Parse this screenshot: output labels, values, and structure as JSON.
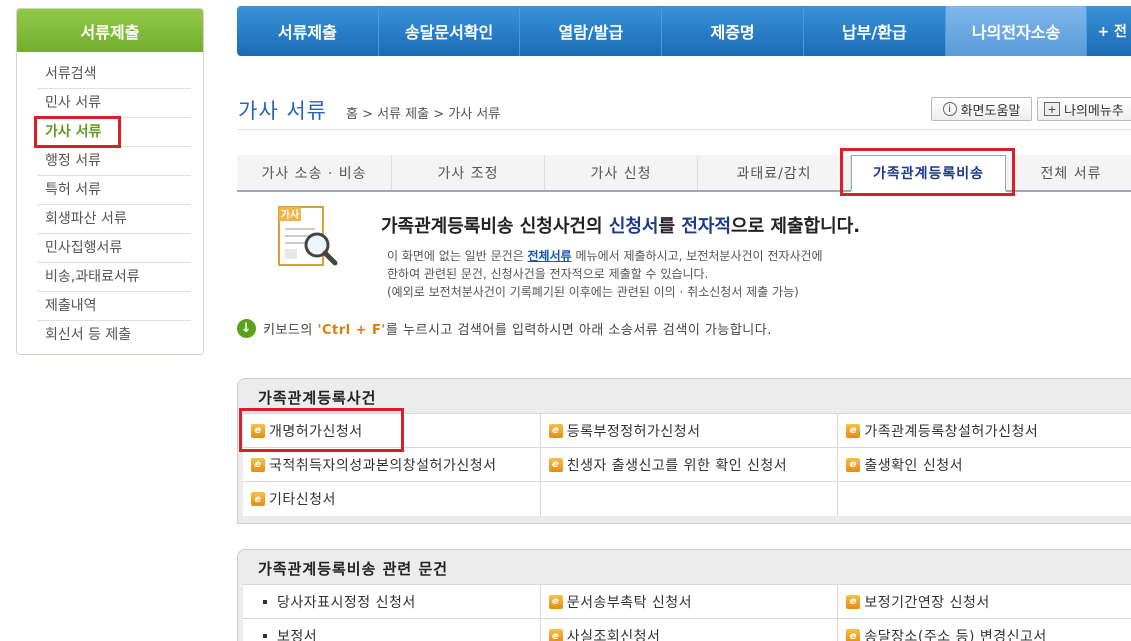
{
  "sidebar": {
    "title": "서류제출",
    "items": [
      {
        "label": "서류검색"
      },
      {
        "label": "민사 서류"
      },
      {
        "label": "가사 서류"
      },
      {
        "label": "행정 서류"
      },
      {
        "label": "특허 서류"
      },
      {
        "label": "회생파산 서류"
      },
      {
        "label": "민사집행서류"
      },
      {
        "label": "비송,과태료서류"
      },
      {
        "label": "제출내역"
      },
      {
        "label": "회신서 등 제출"
      }
    ]
  },
  "topnav": {
    "items": [
      {
        "label": "서류제출"
      },
      {
        "label": "송달문서확인"
      },
      {
        "label": "열람/발급"
      },
      {
        "label": "제증명"
      },
      {
        "label": "납부/환급"
      },
      {
        "label": "나의전자소송"
      }
    ],
    "more": "+ 전"
  },
  "page": {
    "title": "가사 서류",
    "breadcrumb": "홈 > 서류 제출 > 가사 서류",
    "help_label": "화면도움말",
    "mymenu_label": "나의메뉴추"
  },
  "subtabs": [
    {
      "label": "가사 소송 · 비송"
    },
    {
      "label": "가사 조정"
    },
    {
      "label": "가사 신청"
    },
    {
      "label": "과태료/감치"
    },
    {
      "label": "가족관계등록비송"
    },
    {
      "label": "전체 서류"
    }
  ],
  "intro": {
    "icon_text": "가사",
    "title_a": "가족관계등록비송 신청사건의 ",
    "title_b": "신청서",
    "title_c": "를 ",
    "title_d": "전자적",
    "title_e": "으로 제출합니다.",
    "line1_a": "이 화면에 없는 일반 문건은 ",
    "line1_link": "전체서류",
    "line1_b": " 메뉴에서 제출하시고, 보전처분사건이 전자사건에",
    "line2": "한하여 관련된 문건, 신청사건을 전자적으로 제출할 수 있습니다.",
    "line3": "(예외로 보전처분사건이 기록폐기된 이후에는 관련된 이의 · 취소신청서 제출 가능)"
  },
  "tip": {
    "a": "키보드의 ",
    "key": "'Ctrl + F'",
    "b": "를 누르시고 검색어를 입력하시면 아래 소송서류 검색이 가능합니다."
  },
  "section1": {
    "title": "가족관계등록사건",
    "rows": [
      [
        "개명허가신청서",
        "등록부정정허가신청서",
        "가족관계등록창설허가신청서"
      ],
      [
        "국적취득자의성과본의창설허가신청서",
        "친생자 출생신고를 위한 확인 신청서",
        "출생확인 신청서"
      ],
      [
        "기타신청서",
        "",
        ""
      ]
    ]
  },
  "section2": {
    "title": "가족관계등록비송 관련 문건",
    "rows": [
      [
        "당사자표시정정 신청서",
        "문서송부촉탁 신청서",
        "보정기간연장 신청서"
      ],
      [
        "보정서",
        "사실조회신청서",
        "송달장소(주소 등) 변경신고서"
      ]
    ]
  }
}
